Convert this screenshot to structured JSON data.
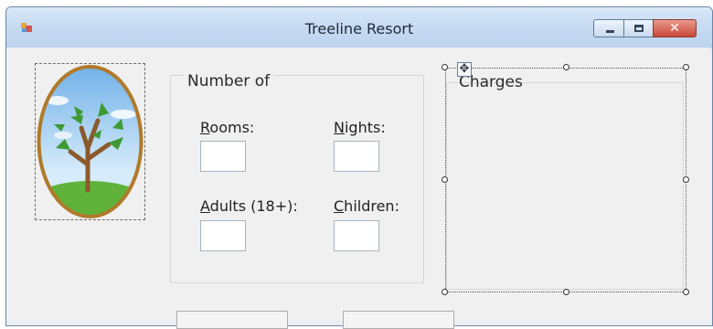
{
  "window": {
    "title": "Treeline Resort"
  },
  "number_group": {
    "legend": "Number of",
    "fields": {
      "rooms": {
        "accel": "R",
        "rest": "ooms:",
        "value": ""
      },
      "nights": {
        "accel": "N",
        "rest": "ights:",
        "value": ""
      },
      "adults": {
        "accel": "A",
        "rest": "dults (18+):",
        "value": ""
      },
      "children": {
        "accel": "C",
        "rest": "hildren:",
        "value": ""
      }
    }
  },
  "charges_group": {
    "legend": "Charges"
  },
  "icons": {
    "app": "form-icon",
    "move": "move-handle-icon",
    "picture": "tree-picture"
  },
  "colors": {
    "titlebar": "#c7dbf2",
    "close_button": "#c8473a",
    "form_background": "#f0f0f0"
  }
}
